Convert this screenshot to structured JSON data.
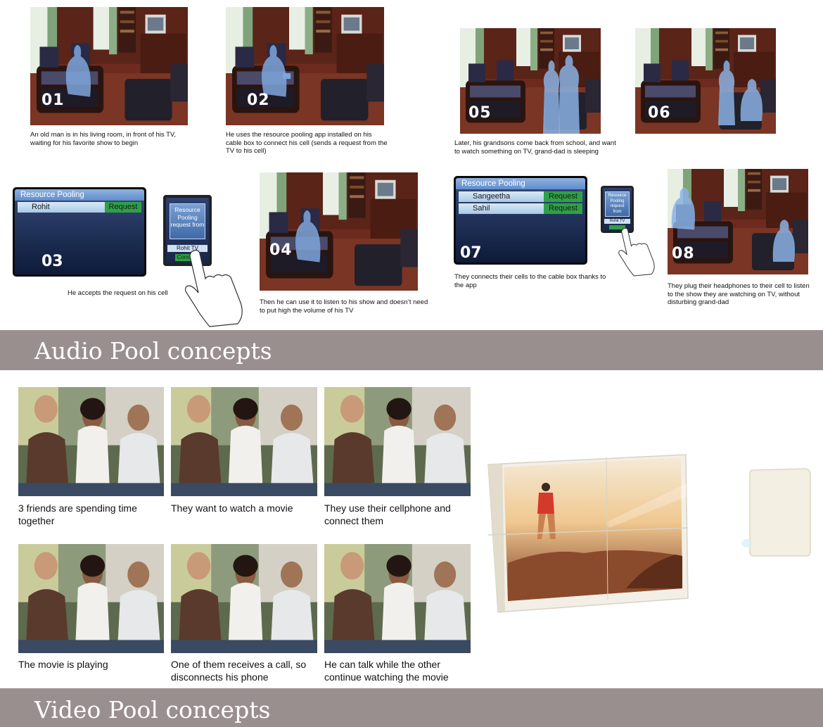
{
  "frames": [
    {
      "num": "01",
      "caption": "An old man is in his living room, in front of his TV, waiting for his favorite show to begin"
    },
    {
      "num": "02",
      "caption": "He uses the resource pooling app installed on his cable box to connect his cell (sends a request from the TV to his cell)"
    },
    {
      "num": "03",
      "caption": "He accepts the request on his cell"
    },
    {
      "num": "04",
      "caption": "Then he can use it to listen to his show and doesn’t need to put high the volume of his TV"
    },
    {
      "num": "05",
      "caption": "Later, his grandsons come back from school, and want to watch something on TV, grand-dad is sleeping"
    },
    {
      "num": "06",
      "caption": ""
    },
    {
      "num": "07",
      "caption": "They connects their cells to the cable box thanks to the app"
    },
    {
      "num": "08",
      "caption": "They plug their headphones to their cell to listen to the show they are watching on TV, without disturbing grand-dad"
    }
  ],
  "panel1": {
    "title": "Resource Pooling",
    "rows": [
      {
        "name": "Rohit",
        "action": "Request"
      }
    ]
  },
  "panel2": {
    "title": "Resource Pooling",
    "rows": [
      {
        "name": "Sangeetha",
        "action": "Request"
      },
      {
        "name": "Sahil",
        "action": "Request"
      }
    ]
  },
  "phone1": {
    "message": "Resource Pooling request from",
    "source": "Rohit TV",
    "button": "Connect"
  },
  "phone2": {
    "message": "Resource Pooling request from",
    "source": "Rohit TV"
  },
  "sections": {
    "audio": "Audio Pool concepts",
    "video": "Video Pool concepts"
  },
  "video_photos": [
    {
      "caption": "3 friends are spending time together"
    },
    {
      "caption": "They want to watch a movie"
    },
    {
      "caption": "They use their cellphone and connect them"
    },
    {
      "caption": "The movie is playing"
    },
    {
      "caption": "One of them receives a call, so disconnects his phone"
    },
    {
      "caption": "He can talk while the other continue watching the movie"
    }
  ],
  "colors": {
    "band": "#9a8f8f",
    "accept_green": "#2fa048",
    "panel_header": "#5f8ccc"
  }
}
